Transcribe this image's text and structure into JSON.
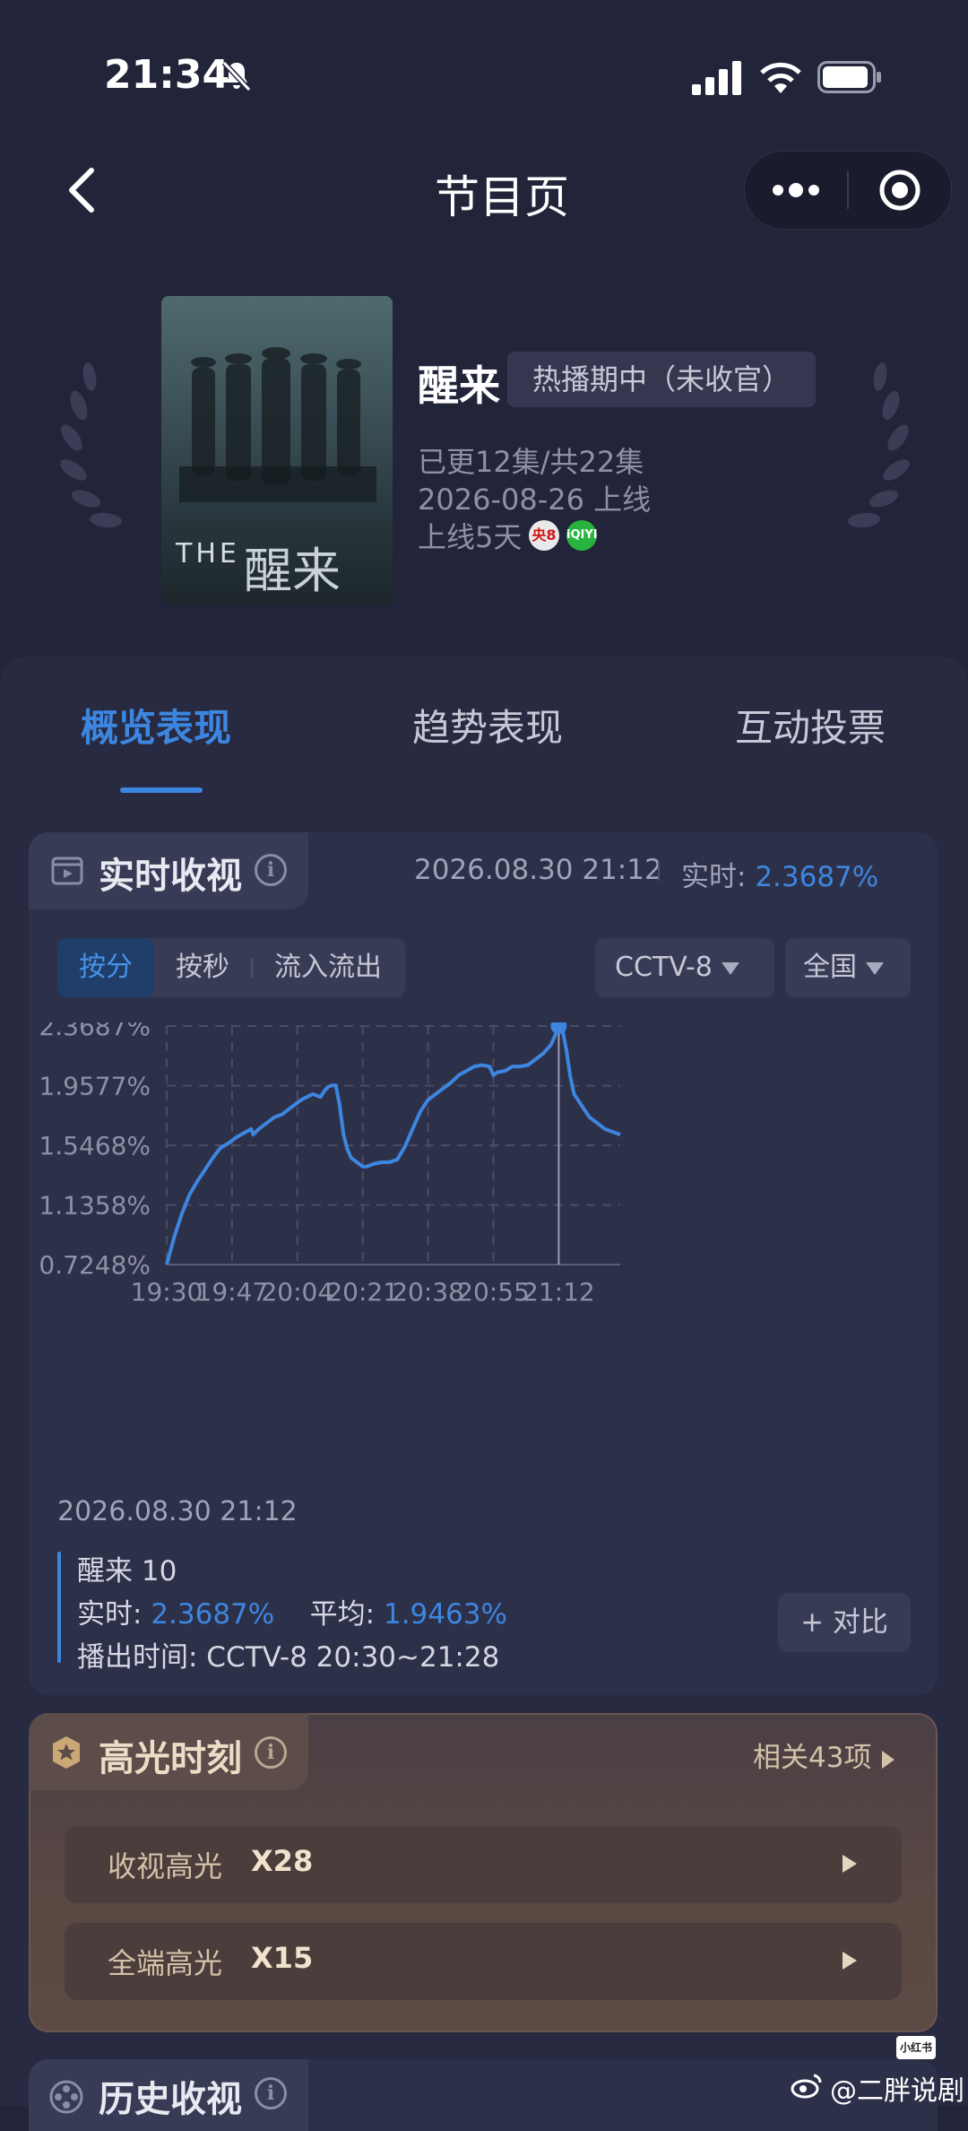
{
  "status_bar": {
    "time": "21:34"
  },
  "nav": {
    "title": "节目页"
  },
  "show": {
    "poster_text": "THE",
    "poster_mark": "醒来",
    "title": "醒来",
    "badge": "热播期中（未收官）",
    "episodes": "已更12集/共22集",
    "premiere": "2026-08-26 上线",
    "days_online": "上线5天",
    "channel_badges": [
      "央8",
      "iQIYI"
    ]
  },
  "tabs": [
    {
      "label": "概览表现",
      "active": true
    },
    {
      "label": "趋势表现",
      "active": false
    },
    {
      "label": "互动投票",
      "active": false
    }
  ],
  "realtime": {
    "title": "实时收视",
    "timestamp": "2026.08.30 21:12",
    "realtime_label": "实时:",
    "realtime_value": "2.3687%",
    "segments": [
      {
        "label": "按分",
        "active": true
      },
      {
        "label": "按秒",
        "active": false
      },
      {
        "label": "流入流出",
        "active": false
      }
    ],
    "channel_select": "CCTV-8",
    "region_select": "全国"
  },
  "chart_data": {
    "type": "line",
    "title": "",
    "xlabel": "",
    "ylabel": "",
    "y_tick_labels": [
      "2.3687%",
      "1.9577%",
      "1.5468%",
      "1.1358%",
      "0.7248%"
    ],
    "y_ticks": [
      2.3687,
      1.9577,
      1.5468,
      1.1358,
      0.7248
    ],
    "x_tick_labels": [
      "19:30",
      "19:47",
      "20:04",
      "20:21",
      "20:38",
      "20:55",
      "21:12"
    ],
    "x_ticks": [
      0,
      17,
      34,
      51,
      68,
      85,
      102
    ],
    "ylim": [
      0.7248,
      2.3687
    ],
    "xlim": [
      0,
      118
    ],
    "grid": true,
    "color": "#3d86e0",
    "marker": {
      "x": 102,
      "y": 2.3687
    },
    "series": [
      {
        "x": [
          0,
          2,
          4,
          6,
          8,
          10,
          12,
          14,
          16,
          18,
          20,
          22,
          22.5,
          24,
          26,
          28,
          30,
          32,
          34,
          35,
          38,
          40,
          41,
          42,
          43,
          44,
          45,
          46,
          47,
          48,
          50,
          51,
          52,
          53,
          54,
          56,
          58,
          60,
          62,
          64,
          66,
          68,
          70,
          72,
          74,
          76,
          78,
          80,
          82,
          84,
          85,
          86,
          88,
          90,
          92,
          94,
          96,
          98,
          100,
          101,
          102,
          103,
          104,
          105,
          106,
          108,
          110,
          112,
          114,
          116,
          118
        ],
        "y": [
          0.7248,
          0.92,
          1.08,
          1.21,
          1.3,
          1.38,
          1.46,
          1.53,
          1.56,
          1.6,
          1.63,
          1.66,
          1.62,
          1.66,
          1.7,
          1.74,
          1.76,
          1.8,
          1.84,
          1.86,
          1.9,
          1.88,
          1.92,
          1.95,
          1.96,
          1.96,
          1.82,
          1.62,
          1.52,
          1.46,
          1.42,
          1.4,
          1.4,
          1.41,
          1.42,
          1.43,
          1.43,
          1.45,
          1.54,
          1.66,
          1.78,
          1.86,
          1.9,
          1.94,
          1.98,
          2.03,
          2.06,
          2.09,
          2.1,
          2.09,
          2.03,
          2.05,
          2.06,
          2.09,
          2.09,
          2.1,
          2.14,
          2.18,
          2.24,
          2.3,
          2.3687,
          2.34,
          2.2,
          2.02,
          1.9,
          1.82,
          1.74,
          1.7,
          1.66,
          1.64,
          1.62
        ]
      }
    ]
  },
  "summary": {
    "date": "2026.08.30 21:12",
    "program": "醒来 10",
    "realtime_label": "实时:",
    "realtime_value": "2.3687%",
    "average_label": "平均:",
    "average_value": "1.9463%",
    "airtime": "播出时间:  CCTV-8 20:30~21:28",
    "compare_button": "+ 对比"
  },
  "highlights": {
    "title": "高光时刻",
    "related": "相关43项",
    "rows": [
      {
        "label": "收视高光",
        "value": "X28"
      },
      {
        "label": "全端高光",
        "value": "X15"
      }
    ]
  },
  "history": {
    "title": "历史收视"
  },
  "watermark": {
    "badge": "小红书",
    "text": "@二胖说剧"
  }
}
